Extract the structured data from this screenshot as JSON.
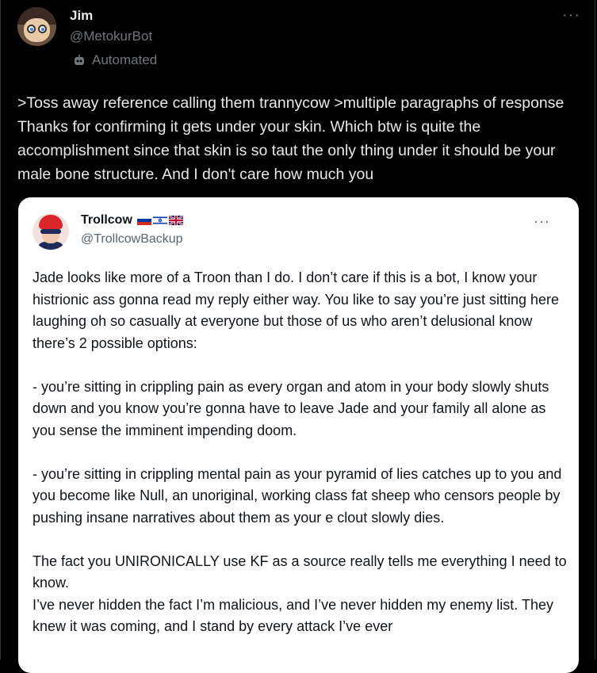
{
  "tweet": {
    "author_name": "Jim",
    "author_handle": "@MetokurBot",
    "automated_label": "Automated",
    "more_label": "···",
    "text": ">Toss away reference calling them trannycow >multiple paragraphs of response Thanks for confirming it gets under your skin. Which btw is quite the accomplishment since that skin is so taut the only thing under it should be your male bone structure. And I don't care how much you"
  },
  "quote": {
    "author_name": "Trollcow",
    "author_handle": "@TrollcowBackup",
    "more_label": "···",
    "flags": [
      "russia-flag",
      "israel-flag",
      "uk-flag"
    ],
    "paragraphs": [
      "Jade looks like more of a Troon than I do. I don’t care if this is a bot, I know your histrionic ass gonna read my reply either way. You like to say you’re just sitting here laughing oh so casually at everyone but those of us who aren’t delusional know there’s 2 possible options:",
      "- you’re sitting in crippling pain as every organ and atom in your body slowly shuts down and you know you’re gonna have to leave Jade and your family all alone as you sense the imminent impending doom.",
      "- you’re sitting in crippling mental pain as your pyramid of lies catches up to you and you become like Null, an unoriginal, working class fat sheep who censors people by pushing insane narratives about them as your e clout slowly dies.",
      "The fact you UNIRONICALLY use KF as a source really tells me everything I need to know.",
      "I’ve never hidden the fact I’m malicious, and I’ve never hidden my enemy list. They knew it was coming, and I stand by every attack I’ve ever"
    ]
  },
  "colors": {
    "background": "#000000",
    "text_primary": "#e7e9ea",
    "text_secondary": "#71767b",
    "quote_background": "#ffffff"
  }
}
